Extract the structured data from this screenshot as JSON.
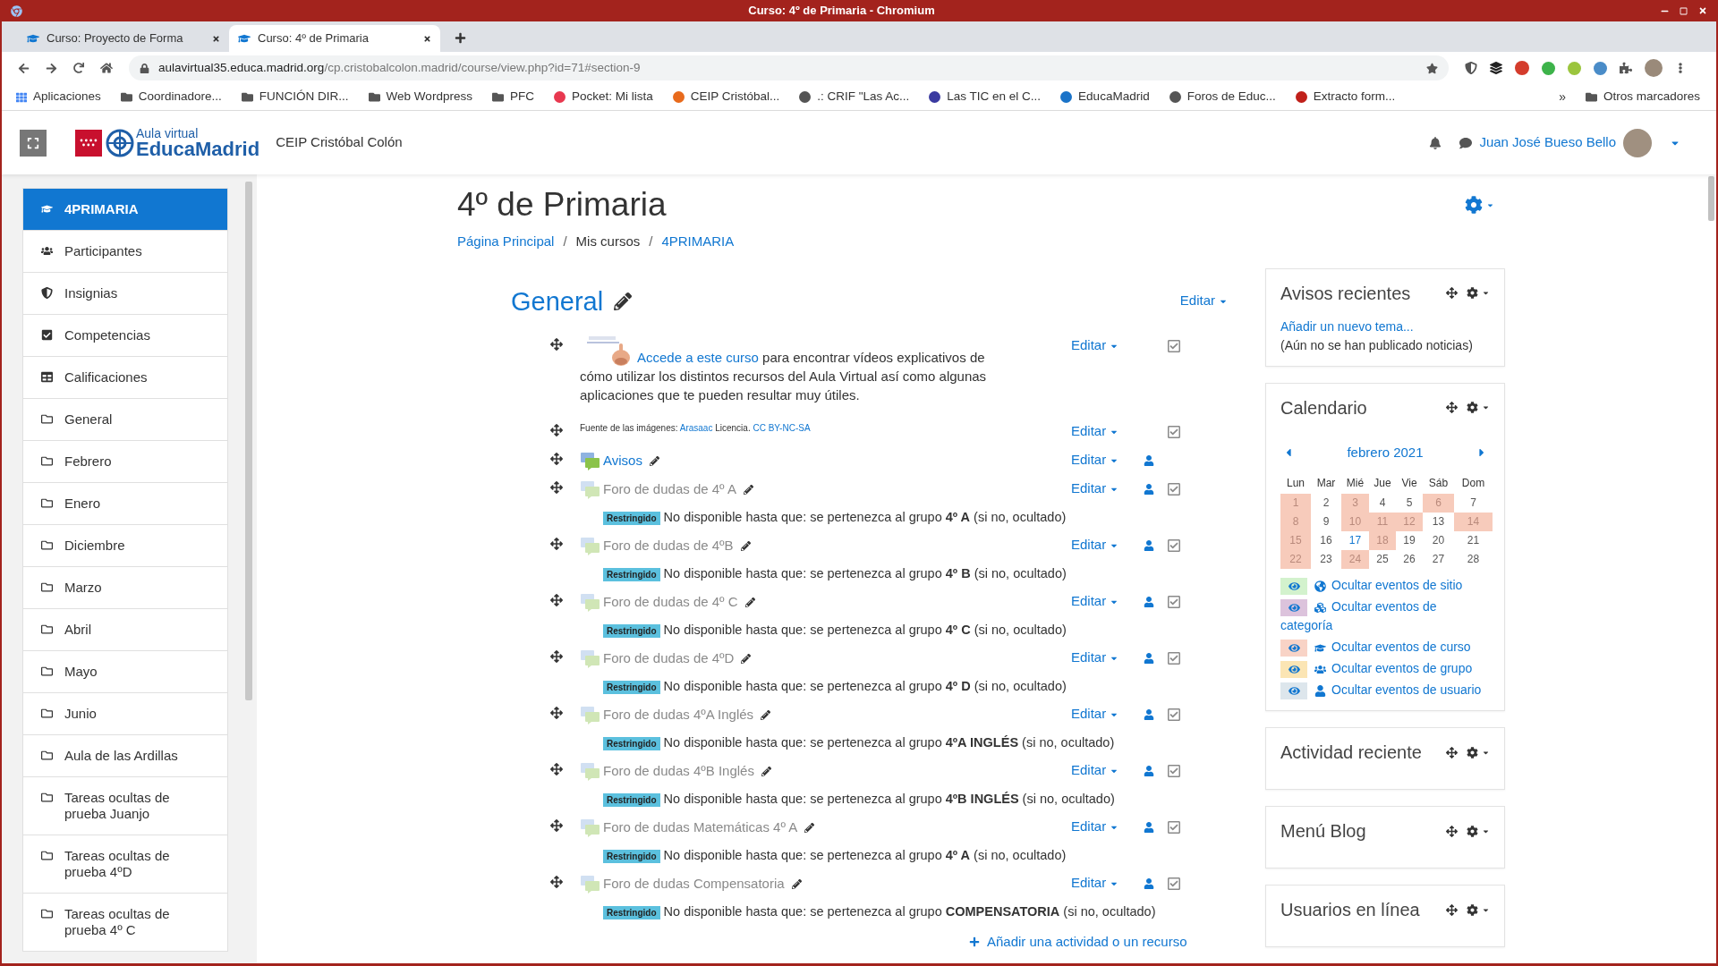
{
  "window": {
    "title": "Curso: 4º de Primaria - Chromium"
  },
  "tabs": [
    {
      "label": "Curso: Proyecto de Forma",
      "selected": false
    },
    {
      "label": "Curso: 4º de Primaria",
      "selected": true
    }
  ],
  "address": {
    "host": "aulavirtual35.educa.madrid.org",
    "path": "/cp.cristobalcolon.madrid/course/view.php?id=71#section-9"
  },
  "bookmarks": [
    {
      "label": "Aplicaciones",
      "kind": "apps"
    },
    {
      "label": "Coordinadore...",
      "kind": "folder"
    },
    {
      "label": "FUNCIÓN DIR...",
      "kind": "folder"
    },
    {
      "label": "Web Wordpress",
      "kind": "folder"
    },
    {
      "label": "PFC",
      "kind": "folder"
    },
    {
      "label": "Pocket: Mi lista",
      "kind": "site",
      "color": "#e8384f"
    },
    {
      "label": "CEIP Cristóbal...",
      "kind": "site",
      "color": "#e86a1c"
    },
    {
      "label": ".: CRIF \"Las Ac...",
      "kind": "site",
      "color": "#555555"
    },
    {
      "label": "Las TIC en el C...",
      "kind": "site",
      "color": "#3a3aa0"
    },
    {
      "label": "EducaMadrid",
      "kind": "site",
      "color": "#1a73c8"
    },
    {
      "label": "Foros de Educ...",
      "kind": "site",
      "color": "#555555"
    },
    {
      "label": "Extracto form...",
      "kind": "site",
      "color": "#c0201a"
    }
  ],
  "bookmarks_overflow": "»",
  "other_bookmarks": "Otros marcadores",
  "site": {
    "logo_small": "Aula virtual",
    "logo_big": "EducaMadrid",
    "school": "CEIP Cristóbal Colón",
    "user": "Juan José Bueso Bello"
  },
  "sidebar": [
    {
      "label": "4PRIMARIA",
      "kind": "course",
      "selected": true
    },
    {
      "label": "Participantes",
      "kind": "users",
      "selected": false
    },
    {
      "label": "Insignias",
      "kind": "shield",
      "selected": false
    },
    {
      "label": "Competencias",
      "kind": "check",
      "selected": false
    },
    {
      "label": "Calificaciones",
      "kind": "table",
      "selected": false
    },
    {
      "label": "General",
      "kind": "folder",
      "selected": false
    },
    {
      "label": "Febrero",
      "kind": "folder",
      "selected": false
    },
    {
      "label": "Enero",
      "kind": "folder",
      "selected": false
    },
    {
      "label": "Diciembre",
      "kind": "folder",
      "selected": false
    },
    {
      "label": "Marzo",
      "kind": "folder",
      "selected": false
    },
    {
      "label": "Abril",
      "kind": "folder",
      "selected": false
    },
    {
      "label": "Mayo",
      "kind": "folder",
      "selected": false
    },
    {
      "label": "Junio",
      "kind": "folder",
      "selected": false
    },
    {
      "label": "Aula de las Ardillas",
      "kind": "folder",
      "selected": false
    },
    {
      "label": "Tareas ocultas de prueba Juanjo",
      "kind": "folder",
      "selected": false
    },
    {
      "label": "Tareas ocultas de prueba 4ºD",
      "kind": "folder",
      "selected": false
    },
    {
      "label": "Tareas ocultas de prueba 4º C",
      "kind": "folder",
      "selected": false
    }
  ],
  "course": {
    "title": "4º de Primaria",
    "separator": "/",
    "breadcrumb": [
      {
        "label": "Página Principal",
        "link": true
      },
      {
        "label": "Mis cursos",
        "link": false
      },
      {
        "label": "4PRIMARIA",
        "link": true
      }
    ]
  },
  "section": {
    "title": "General",
    "edit": "Editar",
    "add": "Añadir una actividad o un recurso",
    "activities": [
      {
        "kind": "label",
        "link": "Accede a este curso",
        "text": " para encontrar vídeos explicativos de cómo utilizar los distintos recursos del Aula Virtual así como algunas aplicaciones que te pueden resultar muy útiles.",
        "edit": "Editar",
        "group_icon": false,
        "checkbox": true,
        "checked": true
      },
      {
        "kind": "source",
        "prefix": "Fuente de las imágenes: ",
        "source_link": "Arasaac",
        "middle": " Licencia. ",
        "license_link": "CC BY-NC-SA",
        "edit": "Editar",
        "group_icon": false,
        "checkbox": true,
        "checked": true
      },
      {
        "kind": "forum",
        "name": "Avisos",
        "hidden": false,
        "edit": "Editar",
        "group_icon": true,
        "checkbox": false
      },
      {
        "kind": "forum",
        "name": "Foro de dudas de 4º A",
        "hidden": true,
        "edit": "Editar",
        "group_icon": true,
        "checkbox": true,
        "checked": true,
        "badge": "Restringido",
        "restriction": "No disponible hasta que: se pertenezca al grupo **4º A** (si no, ocultado)"
      },
      {
        "kind": "forum",
        "name": "Foro de dudas de 4ºB",
        "hidden": true,
        "edit": "Editar",
        "group_icon": true,
        "checkbox": true,
        "checked": true,
        "badge": "Restringido",
        "restriction": "No disponible hasta que: se pertenezca al grupo **4º B** (si no, ocultado)"
      },
      {
        "kind": "forum",
        "name": "Foro de dudas de 4º C",
        "hidden": true,
        "edit": "Editar",
        "group_icon": true,
        "checkbox": true,
        "checked": true,
        "badge": "Restringido",
        "restriction": "No disponible hasta que: se pertenezca al grupo **4º C** (si no, ocultado)"
      },
      {
        "kind": "forum",
        "name": "Foro de dudas de 4ºD",
        "hidden": true,
        "edit": "Editar",
        "group_icon": true,
        "checkbox": true,
        "checked": true,
        "badge": "Restringido",
        "restriction": "No disponible hasta que: se pertenezca al grupo **4º D** (si no, ocultado)"
      },
      {
        "kind": "forum",
        "name": "Foro de dudas 4ºA Inglés",
        "hidden": true,
        "edit": "Editar",
        "group_icon": true,
        "checkbox": true,
        "checked": true,
        "badge": "Restringido",
        "restriction": "No disponible hasta que: se pertenezca al grupo **4ºA INGLÉS** (si no, ocultado)"
      },
      {
        "kind": "forum",
        "name": "Foro de dudas 4ºB Inglés",
        "hidden": true,
        "edit": "Editar",
        "group_icon": true,
        "checkbox": true,
        "checked": true,
        "badge": "Restringido",
        "restriction": "No disponible hasta que: se pertenezca al grupo **4ºB INGLÉS** (si no, ocultado)"
      },
      {
        "kind": "forum",
        "name": "Foro de dudas Matemáticas 4º A",
        "hidden": true,
        "edit": "Editar",
        "group_icon": true,
        "checkbox": true,
        "checked": true,
        "badge": "Restringido",
        "restriction": "No disponible hasta que: se pertenezca al grupo **4º A** (si no, ocultado)"
      },
      {
        "kind": "forum",
        "name": "Foro de dudas Compensatoria",
        "hidden": true,
        "edit": "Editar",
        "group_icon": true,
        "checkbox": true,
        "checked": true,
        "badge": "Restringido",
        "restriction": "No disponible hasta que: se pertenezca al grupo **COMPENSATORIA** (si no, ocultado)"
      }
    ]
  },
  "blocks": [
    {
      "kind": "news",
      "title": "Avisos recientes",
      "link": "Añadir un nuevo tema...",
      "note": "(Aún no se han publicado noticias)"
    },
    {
      "kind": "calendar",
      "title": "Calendario",
      "month": "febrero 2021",
      "weekdays": [
        "Lun",
        "Mar",
        "Mié",
        "Jue",
        "Vie",
        "Sáb",
        "Dom"
      ],
      "weeks": [
        [
          {
            "d": "1",
            "event": true,
            "today": false
          },
          {
            "d": "2",
            "event": false,
            "today": false
          },
          {
            "d": "3",
            "event": true,
            "today": false
          },
          {
            "d": "4",
            "event": false,
            "today": false
          },
          {
            "d": "5",
            "event": false,
            "today": false
          },
          {
            "d": "6",
            "event": true,
            "today": false
          },
          {
            "d": "7",
            "event": false,
            "today": false
          }
        ],
        [
          {
            "d": "8",
            "event": true,
            "today": false
          },
          {
            "d": "9",
            "event": false,
            "today": false
          },
          {
            "d": "10",
            "event": true,
            "today": false
          },
          {
            "d": "11",
            "event": true,
            "today": false
          },
          {
            "d": "12",
            "event": true,
            "today": false
          },
          {
            "d": "13",
            "event": false,
            "today": false
          },
          {
            "d": "14",
            "event": true,
            "today": false
          }
        ],
        [
          {
            "d": "15",
            "event": true,
            "today": false
          },
          {
            "d": "16",
            "event": false,
            "today": false
          },
          {
            "d": "17",
            "event": false,
            "today": true
          },
          {
            "d": "18",
            "event": true,
            "today": false
          },
          {
            "d": "19",
            "event": false,
            "today": false
          },
          {
            "d": "20",
            "event": false,
            "today": false
          },
          {
            "d": "21",
            "event": false,
            "today": false
          }
        ],
        [
          {
            "d": "22",
            "event": true,
            "today": false
          },
          {
            "d": "23",
            "event": false,
            "today": false
          },
          {
            "d": "24",
            "event": true,
            "today": false
          },
          {
            "d": "25",
            "event": false,
            "today": false
          },
          {
            "d": "26",
            "event": false,
            "today": false
          },
          {
            "d": "27",
            "event": false,
            "today": false
          },
          {
            "d": "28",
            "event": false,
            "today": false
          }
        ]
      ],
      "filters": [
        {
          "label": "Ocultar eventos de sitio",
          "kind": "globe",
          "color": "#d3f2cd"
        },
        {
          "label": "Ocultar eventos de categoría",
          "kind": "cubes",
          "color": "#dcc3dc"
        },
        {
          "label": "Ocultar eventos de curso",
          "kind": "course",
          "color": "#f8d3c6"
        },
        {
          "label": "Ocultar eventos de grupo",
          "kind": "group",
          "color": "#fbe5b4"
        },
        {
          "label": "Ocultar eventos de usuario",
          "kind": "user",
          "color": "#dde6ec"
        }
      ]
    },
    {
      "kind": "empty",
      "title": "Actividad reciente"
    },
    {
      "kind": "empty",
      "title": "Menú Blog"
    },
    {
      "kind": "empty",
      "title": "Usuarios en línea"
    }
  ]
}
